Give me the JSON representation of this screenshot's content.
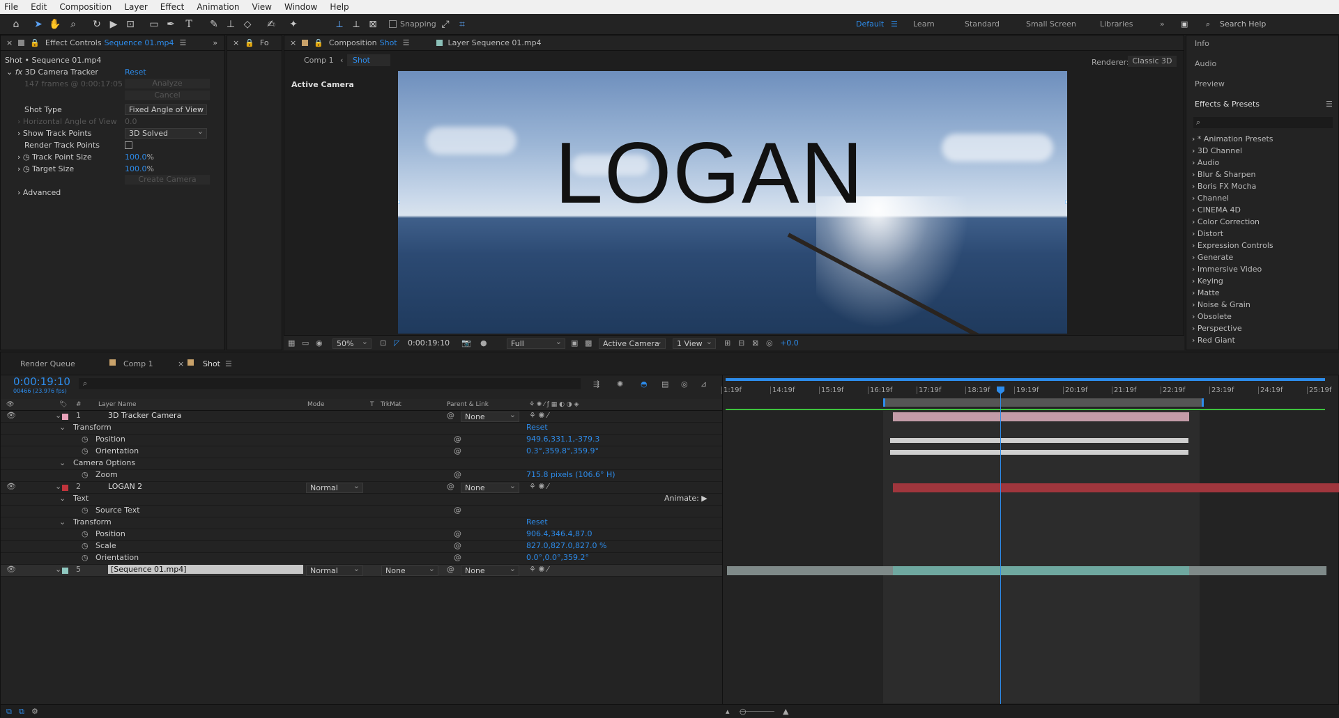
{
  "menu": [
    "File",
    "Edit",
    "Composition",
    "Layer",
    "Effect",
    "Animation",
    "View",
    "Window",
    "Help"
  ],
  "toolbar": {
    "snapping": "Snapping",
    "workspaces": [
      "Default",
      "Learn",
      "Standard",
      "Small Screen",
      "Libraries"
    ],
    "search_placeholder": "Search Help"
  },
  "effect_controls": {
    "tab_label": "Effect Controls",
    "tab_target": "Sequence 01.mp4",
    "second_tab": "Fo",
    "breadcrumb": "Shot • Sequence 01.mp4",
    "effect_name": "3D Camera Tracker",
    "reset": "Reset",
    "frames_info": "147 frames @ 0:00:17:05",
    "analyze": "Analyze",
    "cancel": "Cancel",
    "shot_type_label": "Shot Type",
    "shot_type_value": "Fixed Angle of View",
    "hav_label": "Horizontal Angle of View",
    "hav_value": "0.0",
    "show_track_label": "Show Track Points",
    "show_track_value": "3D Solved",
    "render_track_label": "Render Track Points",
    "track_point_size_label": "Track Point Size",
    "track_point_size_value": "100.0",
    "target_size_label": "Target Size",
    "target_size_value": "100.0",
    "percent": "%",
    "create_camera": "Create Camera",
    "advanced": "Advanced"
  },
  "composition": {
    "tab_label": "Composition",
    "tab_target": "Shot",
    "layer_tab": "Layer Sequence 01.mp4",
    "crumbs": [
      "Comp 1",
      "Shot"
    ],
    "renderer_label": "Renderer:",
    "renderer_value": "Classic 3D",
    "active_camera": "Active Camera",
    "overlay_text": "LOGAN",
    "zoom": "50%",
    "timecode": "0:00:19:10",
    "resolution": "Full",
    "view_camera": "Active Camera",
    "views": "1 View",
    "exposure": "+0.0"
  },
  "right_panel": {
    "items": [
      "Info",
      "Audio",
      "Preview"
    ],
    "effects_title": "Effects & Presets",
    "effects": [
      "* Animation Presets",
      "3D Channel",
      "Audio",
      "Blur & Sharpen",
      "Boris FX Mocha",
      "Channel",
      "CINEMA 4D",
      "Color Correction",
      "Distort",
      "Expression Controls",
      "Generate",
      "Immersive Video",
      "Keying",
      "Matte",
      "Noise & Grain",
      "Obsolete",
      "Perspective",
      "Red Giant"
    ]
  },
  "timeline": {
    "tabs": [
      "Render Queue",
      "Comp 1",
      "Shot"
    ],
    "current_time": "0:00:19:10",
    "frame_info": "00466 (23.976 fps)",
    "col_headers": [
      "#",
      "Layer Name",
      "Mode",
      "T",
      "TrkMat",
      "Parent & Link"
    ],
    "ruler": [
      "1:19f",
      "14:19f",
      "15:19f",
      "16:19f",
      "17:19f",
      "18:19f",
      "19:19f",
      "20:19f",
      "21:19f",
      "22:19f",
      "23:19f",
      "24:19f",
      "25:19f"
    ],
    "rows": [
      {
        "num": "1",
        "name": "3D Tracker Camera",
        "parent": "None",
        "indent": 0
      },
      {
        "name": "Transform",
        "value": "Reset",
        "indent": 1
      },
      {
        "name": "Position",
        "value": "949.6,331.1,-379.3",
        "indent": 2
      },
      {
        "name": "Orientation",
        "value": "0.3°,359.8°,359.9°",
        "indent": 2
      },
      {
        "name": "Camera Options",
        "indent": 1
      },
      {
        "name": "Zoom",
        "value": "715.8 pixels (106.6° H)",
        "indent": 2
      },
      {
        "num": "2",
        "name": "LOGAN 2",
        "mode": "Normal",
        "parent": "None",
        "indent": 0
      },
      {
        "name": "Text",
        "value": "Animate:",
        "indent": 1
      },
      {
        "name": "Source Text",
        "indent": 2
      },
      {
        "name": "Transform",
        "value": "Reset",
        "indent": 1
      },
      {
        "name": "Position",
        "value": "906.4,346.4,87.0",
        "indent": 2
      },
      {
        "name": "Scale",
        "value": "827.0,827.0,827.0 %",
        "indent": 2
      },
      {
        "name": "Orientation",
        "value": "0.0°,0.0°,359.2°",
        "indent": 2
      },
      {
        "num": "5",
        "name": "[Sequence 01.mp4]",
        "mode": "Normal",
        "trkmat": "None",
        "parent": "None",
        "indent": 0
      }
    ]
  },
  "colors": {
    "accent": "#2d8ceb",
    "camera_bar": "#c39ca8",
    "text_bar": "#a0363d",
    "video_bar": "#6fa8a0"
  }
}
